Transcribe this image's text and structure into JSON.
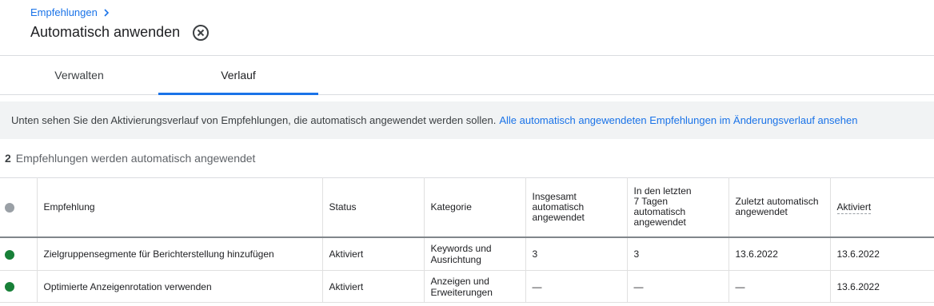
{
  "breadcrumb": {
    "label": "Empfehlungen"
  },
  "page": {
    "title": "Automatisch anwenden"
  },
  "tabs": [
    {
      "label": "Verwalten",
      "active": false
    },
    {
      "label": "Verlauf",
      "active": true
    }
  ],
  "info": {
    "text": "Unten sehen Sie den Aktivierungsverlauf von Empfehlungen, die automatisch angewendet werden sollen.",
    "link": "Alle automatisch angewendeten Empfehlungen im Änderungsverlauf ansehen"
  },
  "summary": {
    "count": "2",
    "text": "Empfehlungen werden automatisch angewendet"
  },
  "table": {
    "headers": {
      "empfehlung": "Empfehlung",
      "status": "Status",
      "kategorie": "Kategorie",
      "insgesamt": [
        "Insgesamt",
        "automatisch",
        "angewendet"
      ],
      "letzte7": [
        "In den letzten",
        "7 Tagen",
        "automatisch",
        "angewendet"
      ],
      "zuletzt": [
        "Zuletzt automatisch",
        "angewendet"
      ],
      "aktiviert": "Aktiviert"
    },
    "rows": [
      {
        "empfehlung": "Zielgruppensegmente für Berichterstellung hinzufügen",
        "status": "Aktiviert",
        "kategorie": [
          "Keywords und",
          "Ausrichtung"
        ],
        "insgesamt": "3",
        "letzte7": "3",
        "zuletzt": "13.6.2022",
        "aktiviert": "13.6.2022",
        "status_color": "#188038"
      },
      {
        "empfehlung": "Optimierte Anzeigenrotation verwenden",
        "status": "Aktiviert",
        "kategorie": [
          "Anzeigen und",
          "Erweiterungen"
        ],
        "insgesamt": "—",
        "letzte7": "—",
        "zuletzt": "—",
        "aktiviert": "13.6.2022",
        "status_color": "#188038"
      }
    ]
  },
  "colors": {
    "accent": "#1a73e8",
    "active_dot": "#188038",
    "inactive_dot": "#9aa0a6"
  },
  "icons": {
    "breadcrumb": "chevron-right-icon",
    "remove": "close-circle-icon"
  }
}
